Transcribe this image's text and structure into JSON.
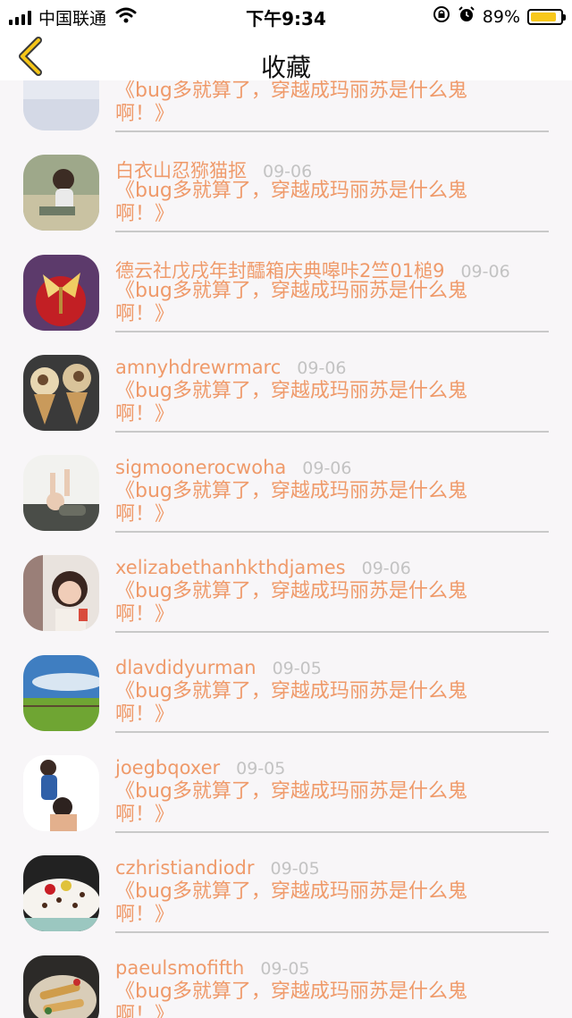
{
  "status_bar": {
    "carrier": "中国联通",
    "time": "下午9:34",
    "battery_percent": "89%",
    "battery_level": 0.89,
    "icons": [
      "signal-icon",
      "wifi-icon",
      "orientation-lock-icon",
      "alarm-icon",
      "battery-icon"
    ]
  },
  "nav": {
    "title": "收藏",
    "back_icon": "chevron-left-icon",
    "accent": "#f5c518"
  },
  "colors": {
    "name_text": "#ef9a6a",
    "date_text": "#c3c3c3",
    "divider": "#c9c9c9",
    "background": "#f8f6f8"
  },
  "favorites": [
    {
      "name": "",
      "date": "",
      "message": "《bug多就算了，穿越成玛丽苏是什么鬼啊！》",
      "avatar": "partial-avatar"
    },
    {
      "name": "白衣山忍猕猫抠",
      "date": "09-06",
      "message": "《bug多就算了，穿越成玛丽苏是什么鬼啊！》",
      "avatar": "girl-illustration-avatar"
    },
    {
      "name": "德云社戊戌年封醽箱庆典嗥咔2竺01槌9",
      "date": "09-06",
      "message": "《bug多就算了，穿越成玛丽苏是什么鬼啊！》",
      "avatar": "apple-butterfly-avatar"
    },
    {
      "name": "amnyhdrewrmarc",
      "date": "09-06",
      "message": "《bug多就算了，穿越成玛丽苏是什么鬼啊！》",
      "avatar": "ice-cream-avatar"
    },
    {
      "name": "sigmoonerocwoha",
      "date": "09-06",
      "message": "《bug多就算了，穿越成玛丽苏是什么鬼啊！》",
      "avatar": "baby-photo-avatar"
    },
    {
      "name": "xelizabethanhkthdjames",
      "date": "09-06",
      "message": "《bug多就算了，穿越成玛丽苏是什么鬼啊！》",
      "avatar": "woman-portrait-avatar"
    },
    {
      "name": "dlavdidyurman",
      "date": "09-05",
      "message": "《bug多就算了，穿越成玛丽苏是什么鬼啊！》",
      "avatar": "grassland-sky-avatar"
    },
    {
      "name": "joegbqoxer",
      "date": "09-05",
      "message": "《bug多就算了，穿越成玛丽苏是什么鬼啊！》",
      "avatar": "father-child-avatar"
    },
    {
      "name": "czhristiandiodr",
      "date": "09-05",
      "message": "《bug多就算了，穿越成玛丽苏是什么鬼啊！》",
      "avatar": "cereal-bowl-avatar"
    },
    {
      "name": "paeulsmofifth",
      "date": "09-05",
      "message": "《bug多就算了，穿越成玛丽苏是什么鬼啊！》",
      "avatar": "food-plate-avatar"
    }
  ]
}
